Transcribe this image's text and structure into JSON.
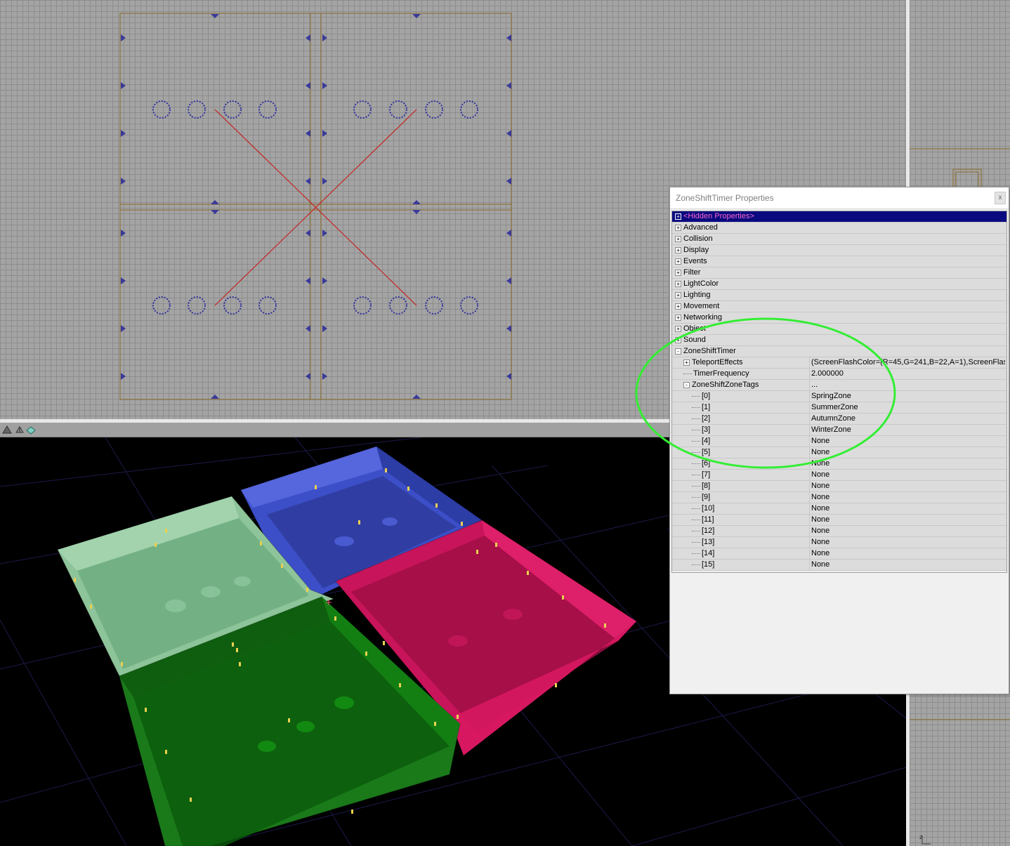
{
  "properties_window": {
    "title": "ZoneShiftTimer Properties",
    "close_label": "x",
    "rows": [
      {
        "name": "<Hidden Properties>",
        "value": "",
        "expander": "+",
        "indent": 0,
        "selected": true
      },
      {
        "name": "Advanced",
        "value": "",
        "expander": "+",
        "indent": 0
      },
      {
        "name": "Collision",
        "value": "",
        "expander": "+",
        "indent": 0
      },
      {
        "name": "Display",
        "value": "",
        "expander": "+",
        "indent": 0
      },
      {
        "name": "Events",
        "value": "",
        "expander": "+",
        "indent": 0
      },
      {
        "name": "Filter",
        "value": "",
        "expander": "+",
        "indent": 0
      },
      {
        "name": "LightColor",
        "value": "",
        "expander": "+",
        "indent": 0
      },
      {
        "name": "Lighting",
        "value": "",
        "expander": "+",
        "indent": 0
      },
      {
        "name": "Movement",
        "value": "",
        "expander": "+",
        "indent": 0
      },
      {
        "name": "Networking",
        "value": "",
        "expander": "+",
        "indent": 0
      },
      {
        "name": "Object",
        "value": "",
        "expander": "+",
        "indent": 0
      },
      {
        "name": "Sound",
        "value": "",
        "expander": "+",
        "indent": 0
      },
      {
        "name": "ZoneShiftTimer",
        "value": "",
        "expander": "-",
        "indent": 0
      },
      {
        "name": "TeleportEffects",
        "value": "(ScreenFlashColor=(R=45,G=241,B=22,A=1),ScreenFlas...",
        "expander": "+",
        "indent": 1
      },
      {
        "name": "TimerFrequency",
        "value": "2.000000",
        "expander": "",
        "indent": 1
      },
      {
        "name": "ZoneShiftZoneTags",
        "value": "...",
        "expander": "-",
        "indent": 1
      },
      {
        "name": "[0]",
        "value": "SpringZone",
        "expander": "",
        "indent": 2
      },
      {
        "name": "[1]",
        "value": "SummerZone",
        "expander": "",
        "indent": 2
      },
      {
        "name": "[2]",
        "value": "AutumnZone",
        "expander": "",
        "indent": 2
      },
      {
        "name": "[3]",
        "value": "WinterZone",
        "expander": "",
        "indent": 2
      },
      {
        "name": "[4]",
        "value": "None",
        "expander": "",
        "indent": 2
      },
      {
        "name": "[5]",
        "value": "None",
        "expander": "",
        "indent": 2
      },
      {
        "name": "[6]",
        "value": "None",
        "expander": "",
        "indent": 2
      },
      {
        "name": "[7]",
        "value": "None",
        "expander": "",
        "indent": 2
      },
      {
        "name": "[8]",
        "value": "None",
        "expander": "",
        "indent": 2
      },
      {
        "name": "[9]",
        "value": "None",
        "expander": "",
        "indent": 2
      },
      {
        "name": "[10]",
        "value": "None",
        "expander": "",
        "indent": 2
      },
      {
        "name": "[11]",
        "value": "None",
        "expander": "",
        "indent": 2
      },
      {
        "name": "[12]",
        "value": "None",
        "expander": "",
        "indent": 2
      },
      {
        "name": "[13]",
        "value": "None",
        "expander": "",
        "indent": 2
      },
      {
        "name": "[14]",
        "value": "None",
        "expander": "",
        "indent": 2
      },
      {
        "name": "[15]",
        "value": "None",
        "expander": "",
        "indent": 2
      }
    ]
  },
  "viewport_3d": {
    "toolbar_icons": [
      "perspective-view-icon",
      "wireframe-mode-icon",
      "textured-mode-icon"
    ],
    "zone_colors": {
      "spring": "#8ec49a",
      "summer": "#1a7a1a",
      "autumn": "#c8145a",
      "winter": "#3c4fc8"
    }
  },
  "side_viewport": {
    "axis_label": "z"
  },
  "annotation": {
    "highlight_color": "#33ee33"
  }
}
